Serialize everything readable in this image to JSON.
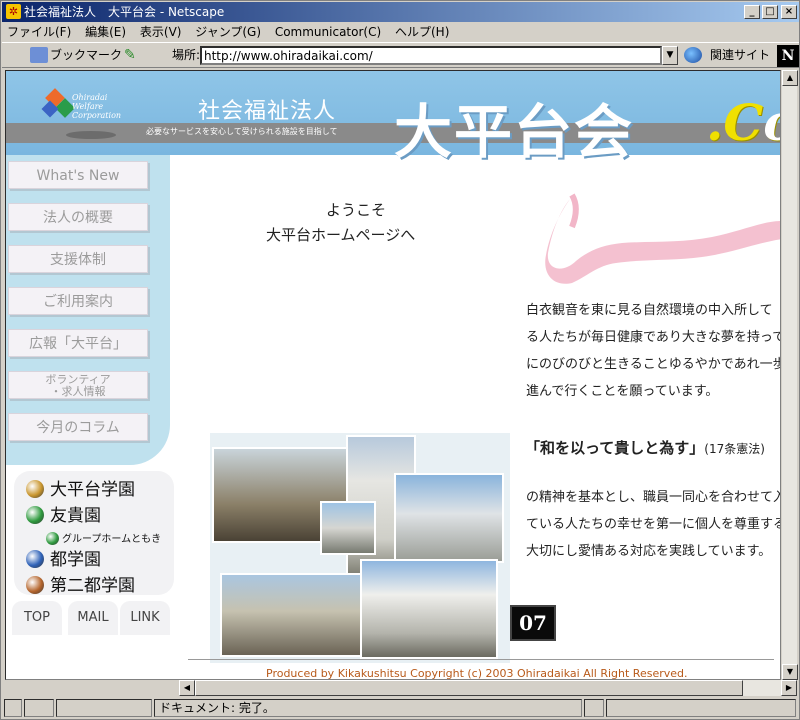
{
  "window": {
    "title": "社会福祉法人　大平台会 - Netscape",
    "min": "_",
    "max": "□",
    "close": "×"
  },
  "menu": [
    "ファイル(F)",
    "編集(E)",
    "表示(V)",
    "ジャンプ(G)",
    "Communicator(C)",
    "ヘルプ(H)"
  ],
  "toolbar": {
    "bookmarks_label": "ブックマーク",
    "location_label": "場所:",
    "url": "http://www.ohiradaikai.com/",
    "related_label": "関連サイト"
  },
  "banner": {
    "logo_text": "Ohiradai Welfare Corporation",
    "org_type": "社会福祉法人",
    "tagline": "必要なサービスを安心して受けられる施設を目指して",
    "site_name": "大平台会",
    "dotcom_c": ".C",
    "dotcom_rest": "om"
  },
  "nav": [
    "What's New",
    "法人の概要",
    "支援体制",
    "ご利用案内",
    "広報「大平台」",
    "ボランティア\n・求人情報",
    "今月のコラム"
  ],
  "facilities": {
    "items": [
      "大平台学園",
      "友貴園",
      "都学園",
      "第二都学園"
    ],
    "sub": "グループホームともき",
    "colors": [
      "#c9962e",
      "#2e9a3e",
      "#2f62b8",
      "#b5652c"
    ]
  },
  "bottom_nav": [
    "TOP",
    "MAIL",
    "LINK"
  ],
  "main": {
    "welcome_1": "ようこそ",
    "welcome_2": "大平台ホームページへ",
    "intro_lines": [
      "白衣観音を東に見る自然環境の中入所して",
      "る人たちが毎日健康であり大きな夢を持って自",
      "にのびのびと生きることゆるやかであれ一歩一",
      "進んで行くことを願っています。"
    ],
    "motto": "「和を以って貴しと為す」",
    "motto_sub": "(17条憲法)",
    "body_lines": [
      "の精神を基本とし、職員一同心を合わせて入所",
      "ている人たちの幸せを第一に個人を尊重するべ",
      "大切にし愛情ある対応を実践しています。"
    ],
    "counter": "07",
    "footer": "Produced by Kikakushitsu Copyright (c) 2003 Ohiradaikai All Right Reserved."
  },
  "status": {
    "text": "ドキュメント: 完了。"
  }
}
